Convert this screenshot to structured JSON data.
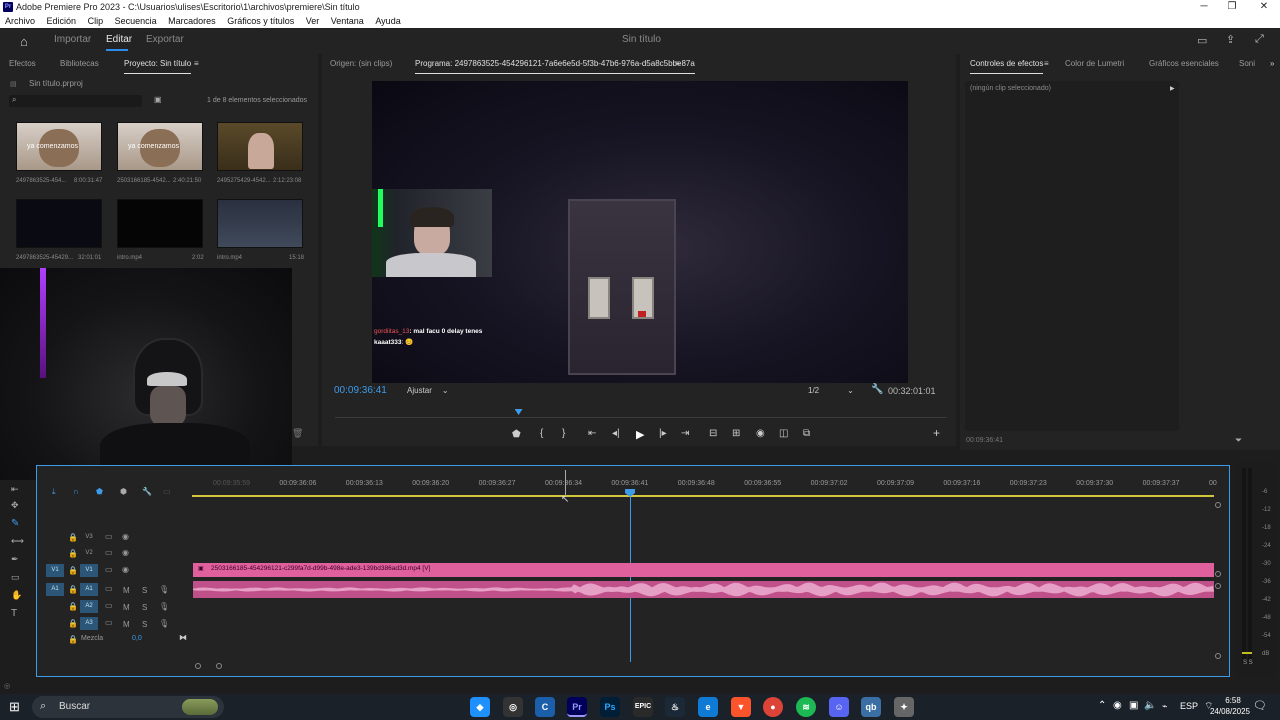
{
  "window": {
    "title": "Adobe Premiere Pro 2023 - C:\\Usuarios\\ulises\\Escritorio\\1\\archivos\\premiere\\Sin título",
    "logo": "Pr",
    "minimize": "─",
    "maximize": "❐",
    "close": "✕"
  },
  "menu": [
    "Archivo",
    "Edición",
    "Clip",
    "Secuencia",
    "Marcadores",
    "Gráficos y títulos",
    "Ver",
    "Ventana",
    "Ayuda"
  ],
  "workspace": {
    "tabs": [
      "Importar",
      "Editar",
      "Exportar"
    ],
    "active": "Editar",
    "project_title": "Sin título"
  },
  "project_panel": {
    "tabs": [
      "Efectos",
      "Bibliotecas",
      "Proyecto: Sin título"
    ],
    "active_tab": "Proyecto: Sin título",
    "file": "Sin título.prproj",
    "selection_info": "1 de 8 elementos seleccionados",
    "search_placeholder": "",
    "items": [
      {
        "name": "2497863525-454...",
        "duration": "8:00:31:47",
        "thumb_text": "ya comenzamos"
      },
      {
        "name": "2503166185-4542...",
        "duration": "2:40:21:50",
        "thumb_text": "ya comenzamos"
      },
      {
        "name": "2495275429-4542...",
        "duration": "2:12:23:08",
        "thumb_text": ""
      },
      {
        "name": "2497863525-45429...",
        "duration": "32:01:01",
        "thumb_text": ""
      },
      {
        "name": "intro.mp4",
        "duration": "2:02",
        "thumb_text": ""
      },
      {
        "name": "intro.mp4",
        "duration": "15:18",
        "thumb_text": ""
      }
    ]
  },
  "program_monitor": {
    "tabs": [
      "Origen: (sin clips)",
      "Programa: 2497863525-454296121-7a6e6e5d-5f3b-47b6-976a-d5a8c5bbe87a"
    ],
    "timecode": "00:09:36:41",
    "fit": "Ajustar",
    "resolution": "1/2",
    "duration": "00:32:01:01",
    "chat": [
      {
        "user": "gordiitas_13",
        "text": ": mal facu 0 delay tenes"
      },
      {
        "user": "kaaat333",
        "text": ": 😊"
      }
    ],
    "playhead_pct": 30
  },
  "effects_panel": {
    "tabs": [
      "Controles de efectos",
      "Color de Lumetri",
      "Gráficos esenciales",
      "Soni"
    ],
    "active_tab": "Controles de efectos",
    "empty_text": "(ningún clip seleccionado)",
    "timecode": "00:09:36:41"
  },
  "timeline": {
    "ruler": [
      "00:09:35:59",
      "00:09:36:06",
      "00:09:36:13",
      "00:09:36:20",
      "00:09:36:27",
      "00:09:36:34",
      "00:09:36:41",
      "00:09:36:48",
      "00:09:36:55",
      "00:09:37:02",
      "00:09:37:09",
      "00:09:37:16",
      "00:09:37:23",
      "00:09:37:30",
      "00:09:37:37",
      "00"
    ],
    "video_tracks": [
      "V3",
      "V2",
      "V1"
    ],
    "audio_tracks": [
      "A1",
      "A2",
      "A3"
    ],
    "source_patch_v": "V1",
    "source_patch_a": "A1",
    "mute_label": "M",
    "solo_label": "S",
    "mix_label": "Mezcla",
    "mix_value": "0,0",
    "clip_name": "2503166185-454296121-c299fa7d-d99b-498e-ade3-139bd386ad3d.mp4 [V]"
  },
  "audio_meter": {
    "ticks": [
      "-6",
      "-12",
      "-18",
      "-24",
      "-30",
      "-36",
      "-42",
      "-48",
      "-54",
      "dB"
    ],
    "solo_labels": "S S"
  },
  "taskbar": {
    "search": "Buscar",
    "lang": "ESP",
    "time": "6:58",
    "date": "24/08/2025"
  },
  "colors": {
    "accent_blue": "#2d8ceb",
    "clip_pink": "#e0609e",
    "ruler_yellow": "#d4c63a"
  }
}
